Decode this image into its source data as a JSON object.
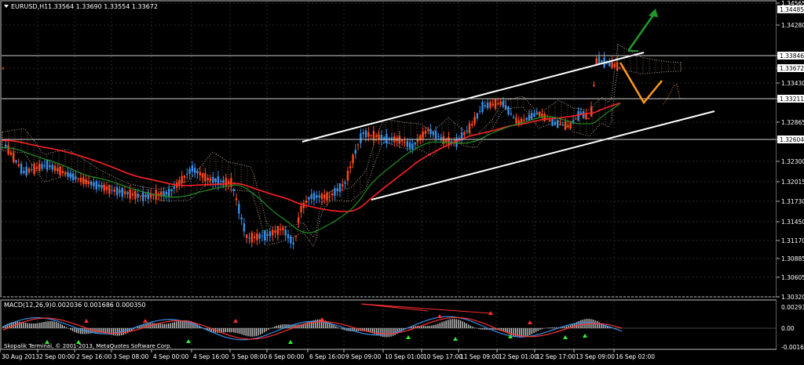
{
  "chart_header": {
    "label": "EURUSD,H1",
    "ohlc": "1.33564 1.33690 1.33554 1.33672"
  },
  "indicator_header": {
    "label": "MACD(12,26,9)",
    "values": "0.002036 0.001686 0.000350"
  },
  "copyright": "Skopalik Terminal, © 2001-2013, MetaQuotes Software Corp.",
  "colors": {
    "background": "#000000",
    "bull_candle": "#3a8ee6",
    "bear_candle": "#ff4a1a",
    "ema_red": "#ff2222",
    "ema_green": "#1f8f1f",
    "ichimoku_cloud": "#c8a898",
    "channel": "#ffffff",
    "projection_orange": "#ff9a1a",
    "projection_green": "#1f9a2a",
    "price_tag_bg": "#ffffff"
  },
  "chart_data": [
    {
      "type": "candlestick",
      "symbol": "EURUSD",
      "timeframe": "H1",
      "last_price": 1.33672,
      "y_ticks": [
        1.34565,
        1.3428,
        1.33846,
        1.33672,
        1.3343,
        1.33211,
        1.32865,
        1.32604,
        1.323,
        1.32015,
        1.3173,
        1.3145,
        1.3117,
        1.30885,
        1.30605,
        1.3032
      ],
      "marked_price_levels": [
        1.34485,
        1.33846,
        1.33672,
        1.33211,
        1.32604
      ],
      "x_labels": [
        "30 Aug 2013",
        "2 Sep 00:00",
        "2 Sep 16:00",
        "3 Sep 08:00",
        "4 Sep 00:00",
        "4 Sep 16:00",
        "5 Sep 08:00",
        "6 Sep 00:00",
        "6 Sep 16:00",
        "9 Sep 09:00",
        "10 Sep 01:00",
        "10 Sep 17:00",
        "11 Sep 09:00",
        "12 Sep 01:00",
        "12 Sep 17:00",
        "13 Sep 09:00",
        "16 Sep 02:00"
      ],
      "ylim": [
        1.3032,
        1.3462
      ],
      "overlays": [
        "EMA (red)",
        "EMA (green)",
        "Ichimoku cloud",
        "ascending channel",
        "projection arrows"
      ]
    },
    {
      "type": "macd",
      "name": "MACD(12,26,9)",
      "main": 0.002036,
      "signal": 0.001686,
      "histogram": 0.00035,
      "y_ticks": [
        "0.002937",
        "0.00",
        "-0.0016"
      ],
      "ylim": [
        -0.0016,
        0.0033
      ]
    }
  ]
}
